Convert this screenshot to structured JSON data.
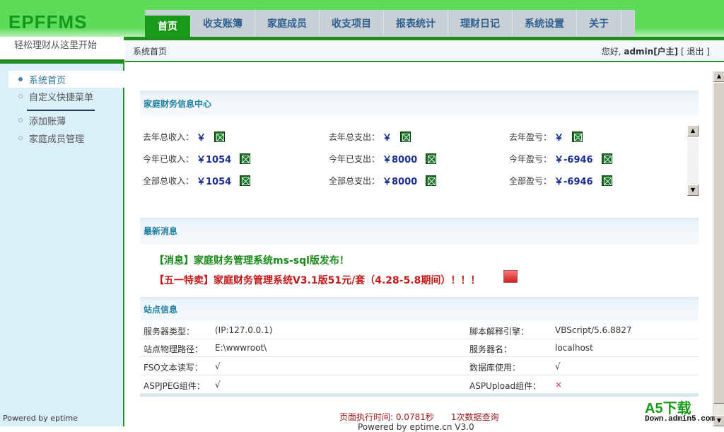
{
  "app": {
    "logo": "EPFFMS",
    "slogan": "轻松理财从这里开始"
  },
  "nav": {
    "tabs": [
      "首页",
      "收支账簿",
      "家庭成员",
      "收支项目",
      "报表统计",
      "理财日记",
      "系统设置",
      "关于"
    ],
    "active": 0
  },
  "header": {
    "breadcrumb": "系统首页",
    "greeting": "您好,",
    "user": "admin[户主]",
    "logout": "[ 退出 ]"
  },
  "sidebar": {
    "items": [
      {
        "label": "系统首页",
        "active": true
      },
      {
        "label": "自定义快捷菜单"
      },
      {
        "label": "添加账薄"
      },
      {
        "label": "家庭成员管理"
      }
    ],
    "powered": "Powered by eptime"
  },
  "finance": {
    "title": "家庭财务信息中心",
    "rows": [
      [
        {
          "label": "去年总收入：",
          "value": "￥"
        },
        {
          "label": "去年总支出：",
          "value": "￥"
        },
        {
          "label": "去年盈亏：",
          "value": "￥"
        }
      ],
      [
        {
          "label": "今年已收入：",
          "value": "￥1054"
        },
        {
          "label": "今年已支出：",
          "value": "￥8000"
        },
        {
          "label": "今年盈亏：",
          "value": "￥-6946"
        }
      ],
      [
        {
          "label": "全部总收入：",
          "value": "￥1054"
        },
        {
          "label": "全部总支出：",
          "value": "￥8000"
        },
        {
          "label": "全部盈亏：",
          "value": "￥-6946"
        }
      ]
    ]
  },
  "news": {
    "title": "最新消息",
    "items": [
      {
        "text": "【消息】家庭财务管理系统ms-sql版发布！",
        "color": "#1a8a1a"
      },
      {
        "text": "【五一特卖】家庭财务管理系统V3.1版51元/套（4.28-5.8期间）！！！",
        "color": "#c01818"
      }
    ]
  },
  "site": {
    "title": "站点信息",
    "rows": [
      [
        "服务器类型：",
        "(IP:127.0.0.1)",
        "脚本解释引擎：",
        "VBScript/5.6.8827"
      ],
      [
        "站点物理路径：",
        "E:\\wwwroot\\",
        "服务器名：",
        "localhost"
      ],
      [
        "FSO文本读写：",
        "√",
        "数据库使用：",
        "√"
      ],
      [
        "ASPJPEG组件：",
        "√",
        "ASPUpload组件：",
        "×"
      ]
    ]
  },
  "footer": {
    "exec": "页面执行时间: 0.0781秒　　1次数据查询",
    "powered": "Powered by eptime.cn V3.0"
  },
  "watermark": {
    "main": "A5下载",
    "sub": "Down.admin5.com"
  }
}
